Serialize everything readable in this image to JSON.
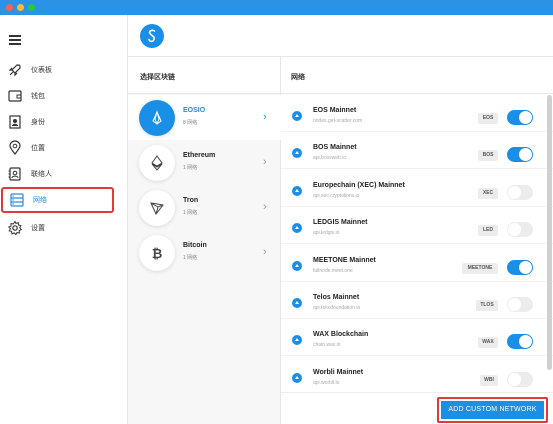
{
  "sidebar": {
    "items": [
      {
        "label": "仪表板",
        "icon": "rocket-icon"
      },
      {
        "label": "钱包",
        "icon": "wallet-icon"
      },
      {
        "label": "身份",
        "icon": "id-card-icon"
      },
      {
        "label": "位置",
        "icon": "location-pin-icon"
      },
      {
        "label": "联络人",
        "icon": "contacts-icon"
      },
      {
        "label": "网络",
        "icon": "server-icon",
        "active": true
      },
      {
        "label": "设置",
        "icon": "gear-icon"
      }
    ]
  },
  "chains_panel": {
    "title": "选择区块链",
    "items": [
      {
        "name": "EOSIO",
        "count": "8 网络",
        "selected": true
      },
      {
        "name": "Ethereum",
        "count": "1 网络"
      },
      {
        "name": "Tron",
        "count": "1 网络"
      },
      {
        "name": "Bitcoin",
        "count": "1 网络"
      }
    ]
  },
  "networks_panel": {
    "title": "网络",
    "items": [
      {
        "name": "EOS Mainnet",
        "host": "nodes.get-scatter.com",
        "badge": "EOS",
        "enabled": true
      },
      {
        "name": "BOS Mainnet",
        "host": "api.bossweb.io",
        "badge": "BOS",
        "enabled": true
      },
      {
        "name": "Europechain (XEC) Mainnet",
        "host": "api.xec.cryptolions.io",
        "badge": "XEC",
        "enabled": false
      },
      {
        "name": "LEDGIS Mainnet",
        "host": "api.ledgis.io",
        "badge": "LED",
        "enabled": false
      },
      {
        "name": "MEETONE Mainnet",
        "host": "fullnode.meet.one",
        "badge": "MEETONE",
        "enabled": true
      },
      {
        "name": "Telos Mainnet",
        "host": "api.telosfoundation.io",
        "badge": "TLOS",
        "enabled": false
      },
      {
        "name": "WAX Blockchain",
        "host": "chain.wax.io",
        "badge": "WAX",
        "enabled": true
      },
      {
        "name": "Worbli Mainnet",
        "host": "api.worbli.io",
        "badge": "WBI",
        "enabled": false
      }
    ]
  },
  "footer": {
    "add_button": "ADD CUSTOM NETWORK"
  },
  "colors": {
    "accent": "#1a8fe8",
    "highlight": "#e03a3a",
    "titlebar": "#2a93e6"
  }
}
